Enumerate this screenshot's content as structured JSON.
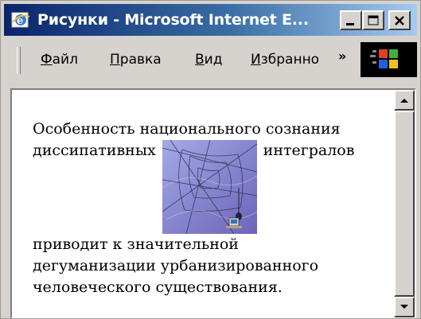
{
  "window": {
    "title": "Рисунки - Microsoft Internet E..."
  },
  "menu": {
    "items": [
      {
        "acc": "Ф",
        "rest": "айл"
      },
      {
        "acc": "П",
        "rest": "равка"
      },
      {
        "acc": "В",
        "rest": "ид"
      },
      {
        "acc": "И",
        "rest": "збранно"
      }
    ],
    "overflow": "»"
  },
  "page": {
    "line1": "Особенность национального сознания",
    "line2_before": "диссипативных",
    "line2_after": "интегралов",
    "line3": "приводит к значительной",
    "line4": "дегуманизации урбанизированного",
    "line5": "человеческого существования."
  },
  "icons": {
    "app": "ie-icon",
    "figure": "spider-web-image"
  },
  "colors": {
    "title_start": "#0a246a",
    "title_end": "#a6caf0",
    "chrome": "#d6d3ce",
    "figure_bg": "#8f8fd6"
  }
}
